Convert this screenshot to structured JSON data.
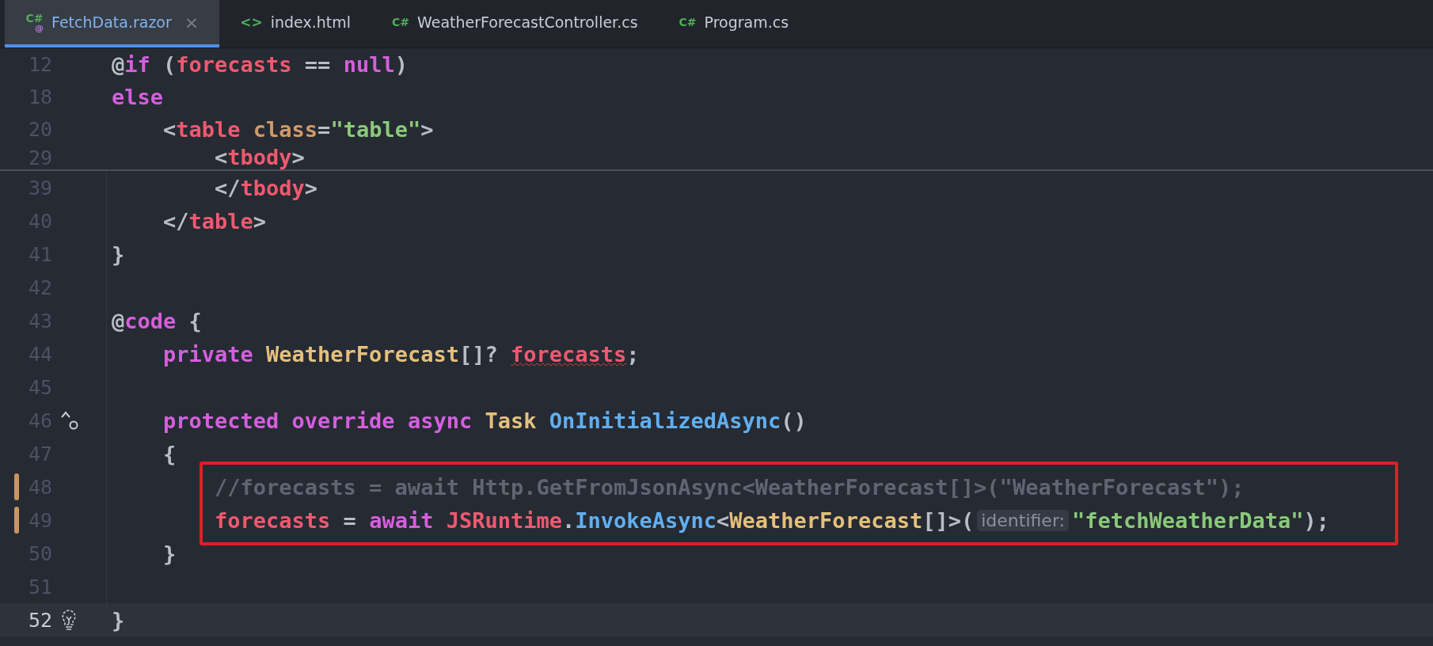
{
  "tabs": [
    {
      "label": "FetchData.razor",
      "icon": "C#",
      "icon_sub": "@",
      "selected": true,
      "close": "×"
    },
    {
      "label": "index.html",
      "icon": "<>",
      "selected": false
    },
    {
      "label": "WeatherForecastController.cs",
      "icon": "C#",
      "selected": false
    },
    {
      "label": "Program.cs",
      "icon": "C#",
      "selected": false
    }
  ],
  "sticky_lines": [
    {
      "number": "12",
      "tokens": [
        {
          "t": "@",
          "kind": "punc"
        },
        {
          "t": "if",
          "kind": "kw"
        },
        {
          "t": " (",
          "kind": "punc"
        },
        {
          "t": "forecasts",
          "kind": "var"
        },
        {
          "t": " == ",
          "kind": "punc"
        },
        {
          "t": "null",
          "kind": "kw"
        },
        {
          "t": ")",
          "kind": "punc"
        }
      ]
    },
    {
      "number": "18",
      "tokens": [
        {
          "t": "else",
          "kind": "kw"
        }
      ]
    },
    {
      "number": "20",
      "tokens": [
        {
          "t": "    <",
          "kind": "punc"
        },
        {
          "t": "table",
          "kind": "var"
        },
        {
          "t": " class",
          "kind": "attr"
        },
        {
          "t": "=",
          "kind": "punc"
        },
        {
          "t": "\"table\"",
          "kind": "str"
        },
        {
          "t": ">",
          "kind": "punc"
        }
      ]
    },
    {
      "number": "29",
      "tokens": [
        {
          "t": "        <",
          "kind": "punc"
        },
        {
          "t": "tbody",
          "kind": "var"
        },
        {
          "t": ">",
          "kind": "punc"
        }
      ]
    }
  ],
  "lines": [
    {
      "number": "39",
      "tokens": [
        {
          "t": "        </",
          "kind": "punc"
        },
        {
          "t": "tbody",
          "kind": "var"
        },
        {
          "t": ">",
          "kind": "punc"
        }
      ]
    },
    {
      "number": "40",
      "tokens": [
        {
          "t": "    </",
          "kind": "punc"
        },
        {
          "t": "table",
          "kind": "var"
        },
        {
          "t": ">",
          "kind": "punc"
        }
      ]
    },
    {
      "number": "41",
      "tokens": [
        {
          "t": "}",
          "kind": "punc"
        }
      ]
    },
    {
      "number": "42"
    },
    {
      "number": "43",
      "tokens": [
        {
          "t": "@",
          "kind": "punc"
        },
        {
          "t": "code",
          "kind": "kw"
        },
        {
          "t": " {",
          "kind": "punc"
        }
      ]
    },
    {
      "number": "44",
      "tokens": [
        {
          "t": "    private ",
          "kind": "kw"
        },
        {
          "t": "WeatherForecast",
          "kind": "type"
        },
        {
          "t": "[]? ",
          "kind": "punc"
        },
        {
          "t": "forecasts",
          "kind": "var",
          "error": true
        },
        {
          "t": ";",
          "kind": "punc"
        }
      ]
    },
    {
      "number": "45"
    },
    {
      "number": "46",
      "gutter_icon": {
        "kind": "override"
      },
      "tokens": [
        {
          "t": "    protected ",
          "kind": "kw"
        },
        {
          "t": "override ",
          "kind": "kw"
        },
        {
          "t": "async ",
          "kind": "kw"
        },
        {
          "t": "Task ",
          "kind": "type"
        },
        {
          "t": "OnInitializedAsync",
          "kind": "fn"
        },
        {
          "t": "()",
          "kind": "punc"
        }
      ]
    },
    {
      "number": "47",
      "tokens": [
        {
          "t": "    {",
          "kind": "punc"
        }
      ]
    },
    {
      "number": "48",
      "modified": true,
      "tokens": [
        {
          "t": "        //forecasts = await Http.GetFromJsonAsync<WeatherForecast[]>(\"WeatherForecast\");",
          "kind": "comment"
        }
      ]
    },
    {
      "number": "49",
      "modified": true,
      "tokens": [
        {
          "t": "        forecasts",
          "kind": "var"
        },
        {
          "t": " = ",
          "kind": "punc"
        },
        {
          "t": "await ",
          "kind": "kw"
        },
        {
          "t": "JSRuntime",
          "kind": "var"
        },
        {
          "t": ".",
          "kind": "punc"
        },
        {
          "t": "InvokeAsync",
          "kind": "fn"
        },
        {
          "t": "<",
          "kind": "punc"
        },
        {
          "t": "WeatherForecast",
          "kind": "type"
        },
        {
          "t": "[]>(",
          "kind": "punc"
        },
        {
          "t": "identifier:",
          "kind": "hint"
        },
        {
          "t": "\"fetchWeatherData\"",
          "kind": "str"
        },
        {
          "t": ");",
          "kind": "punc"
        }
      ]
    },
    {
      "number": "50",
      "tokens": [
        {
          "t": "    }",
          "kind": "punc"
        }
      ]
    },
    {
      "number": "51"
    },
    {
      "number": "52",
      "gutter_icon": {
        "kind": "bulb"
      },
      "current": true,
      "tokens": [
        {
          "t": "}",
          "kind": "punc"
        }
      ]
    }
  ]
}
